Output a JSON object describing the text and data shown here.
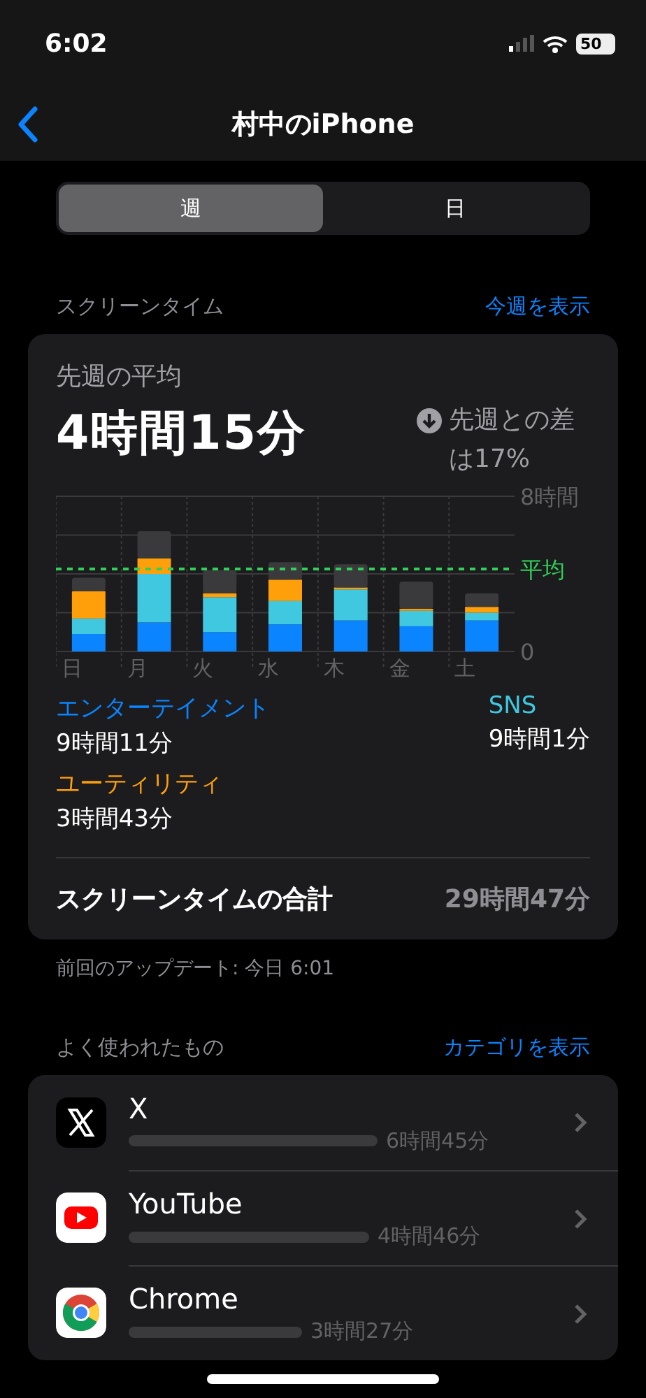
{
  "status_bar": {
    "time": "6:02",
    "battery": "50"
  },
  "nav": {
    "title": "村中のiPhone"
  },
  "segments": [
    {
      "label": "週",
      "selected": true
    },
    {
      "label": "日",
      "selected": false
    }
  ],
  "screen_time_header": {
    "title": "スクリーンタイム",
    "link": "今週を表示"
  },
  "summary": {
    "label": "先週の平均",
    "value": "4時間15分",
    "change": "先週との差は17%",
    "chart_data": {
      "type": "bar",
      "stacked": true,
      "categories": [
        "日",
        "月",
        "火",
        "水",
        "木",
        "金",
        "土"
      ],
      "series": [
        {
          "name": "エンターテイメント",
          "color": "#0a84ff",
          "values": [
            0.9,
            1.5,
            1.0,
            1.4,
            1.6,
            1.3,
            1.6
          ]
        },
        {
          "name": "SNS",
          "color": "#40c8e0",
          "values": [
            0.8,
            2.5,
            1.8,
            1.2,
            1.6,
            0.8,
            0.4
          ]
        },
        {
          "name": "ユーティリティ",
          "color": "#ff9f0a",
          "values": [
            1.4,
            0.8,
            0.2,
            1.1,
            0.1,
            0.1,
            0.3
          ]
        },
        {
          "color": "#3a3a3c",
          "values": [
            0.7,
            1.4,
            1.2,
            0.9,
            1.2,
            1.4,
            0.7
          ]
        }
      ],
      "ylim": [
        0,
        8
      ],
      "yticks": [
        {
          "value": 0,
          "label": "0"
        },
        {
          "value": 8,
          "label": "8時間"
        }
      ],
      "ref_lines": [
        {
          "axis": "y",
          "value": 4.25,
          "label": "平均",
          "color": "#30d158"
        }
      ]
    },
    "legend": [
      {
        "time": "9時間11分"
      },
      {
        "time": "9時間1分"
      },
      {
        "time": "3時間43分"
      }
    ],
    "total": {
      "label": "スクリーンタイムの合計",
      "value": "29時間47分"
    }
  },
  "updated": "前回のアップデート: 今日 6:01",
  "most_used_header": {
    "title": "よく使われたもの",
    "link": "カテゴリを表示"
  },
  "apps": [
    {
      "kind": "x",
      "name": "X",
      "time": "6時間45分"
    },
    {
      "kind": "youtube",
      "name": "YouTube",
      "time": "4時間46分"
    },
    {
      "kind": "chrome",
      "name": "Chrome",
      "time": "3時間27分"
    }
  ]
}
